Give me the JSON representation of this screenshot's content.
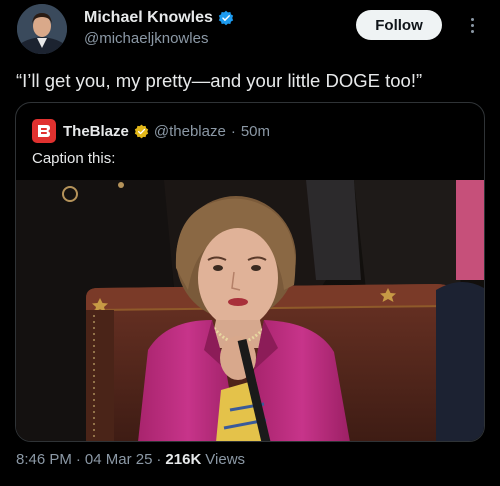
{
  "author": {
    "display_name": "Michael Knowles",
    "handle": "@michaeljknowles",
    "verified": true
  },
  "actions": {
    "follow_label": "Follow",
    "more_icon": "more-vertical-icon"
  },
  "tweet": {
    "text": "“I’ll get you, my pretty—and your little DOGE too!”"
  },
  "quoted": {
    "display_name": "TheBlaze",
    "handle": "@theblaze",
    "separator": "·",
    "time": "50m",
    "text": "Caption this:",
    "logo_color": "#e0312f"
  },
  "meta": {
    "time": "8:46 PM",
    "sep1": "·",
    "date": "04 Mar 25",
    "sep2": "·",
    "views_count": "216K",
    "views_label": "Views"
  },
  "colors": {
    "background": "#000000",
    "text": "#e7e9ea",
    "muted": "#8b98a5",
    "verified_blue": "#1d9bf0",
    "verified_gold": "#e2b719",
    "border": "#2f3336"
  }
}
